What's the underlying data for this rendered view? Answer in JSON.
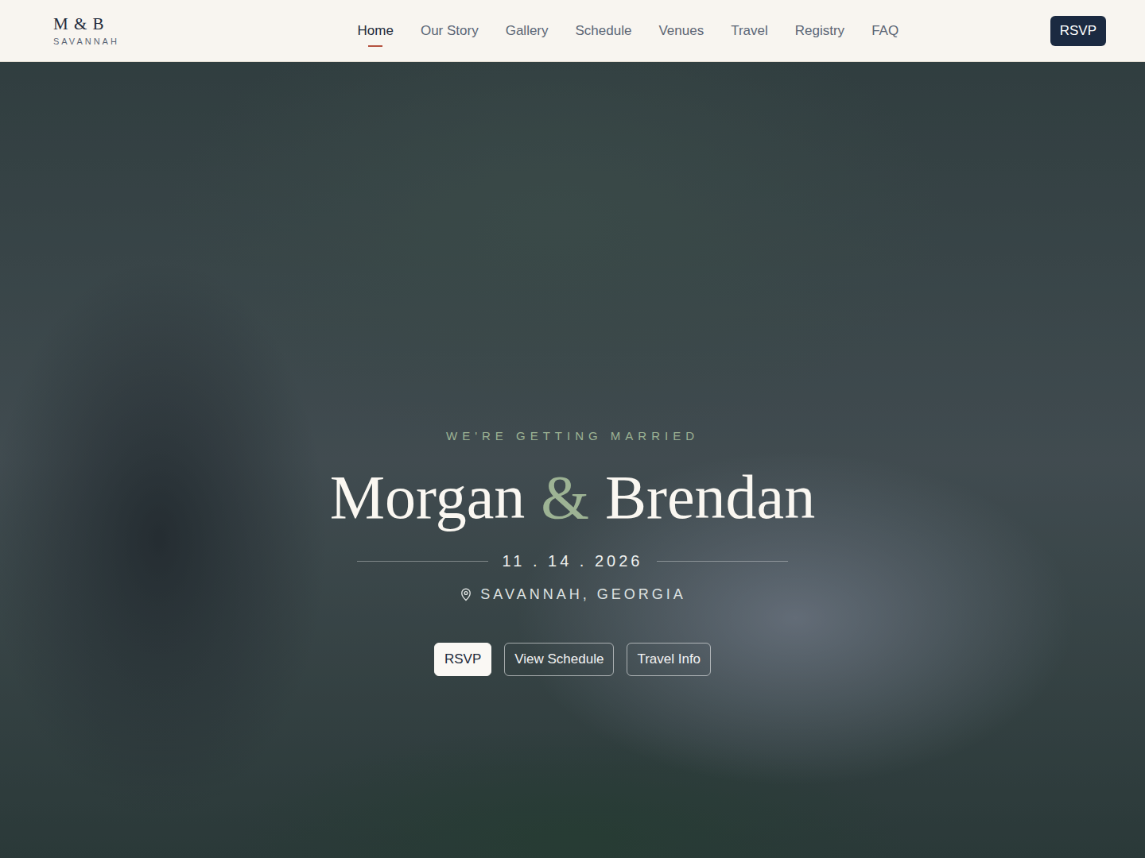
{
  "brand": {
    "monogram": "M & B",
    "place": "SAVANNAH"
  },
  "nav": [
    {
      "label": "Home",
      "selected": true
    },
    {
      "label": "Our Story",
      "selected": false
    },
    {
      "label": "Gallery",
      "selected": false
    },
    {
      "label": "Schedule",
      "selected": false
    },
    {
      "label": "Venues",
      "selected": false
    },
    {
      "label": "Travel",
      "selected": false
    },
    {
      "label": "Registry",
      "selected": false
    },
    {
      "label": "FAQ",
      "selected": false
    }
  ],
  "header_button": "RSVP",
  "hero": {
    "eyebrow": "WE'RE GETTING MARRIED",
    "name1": "Morgan",
    "ampersand": "&",
    "name2": "Brendan",
    "date": "11 . 14 . 2026",
    "location": "SAVANNAH, GEORGIA",
    "buttons": [
      {
        "label": "RSVP",
        "kind": "solid"
      },
      {
        "label": "View Schedule",
        "kind": "outline"
      },
      {
        "label": "Travel Info",
        "kind": "outline"
      }
    ]
  }
}
